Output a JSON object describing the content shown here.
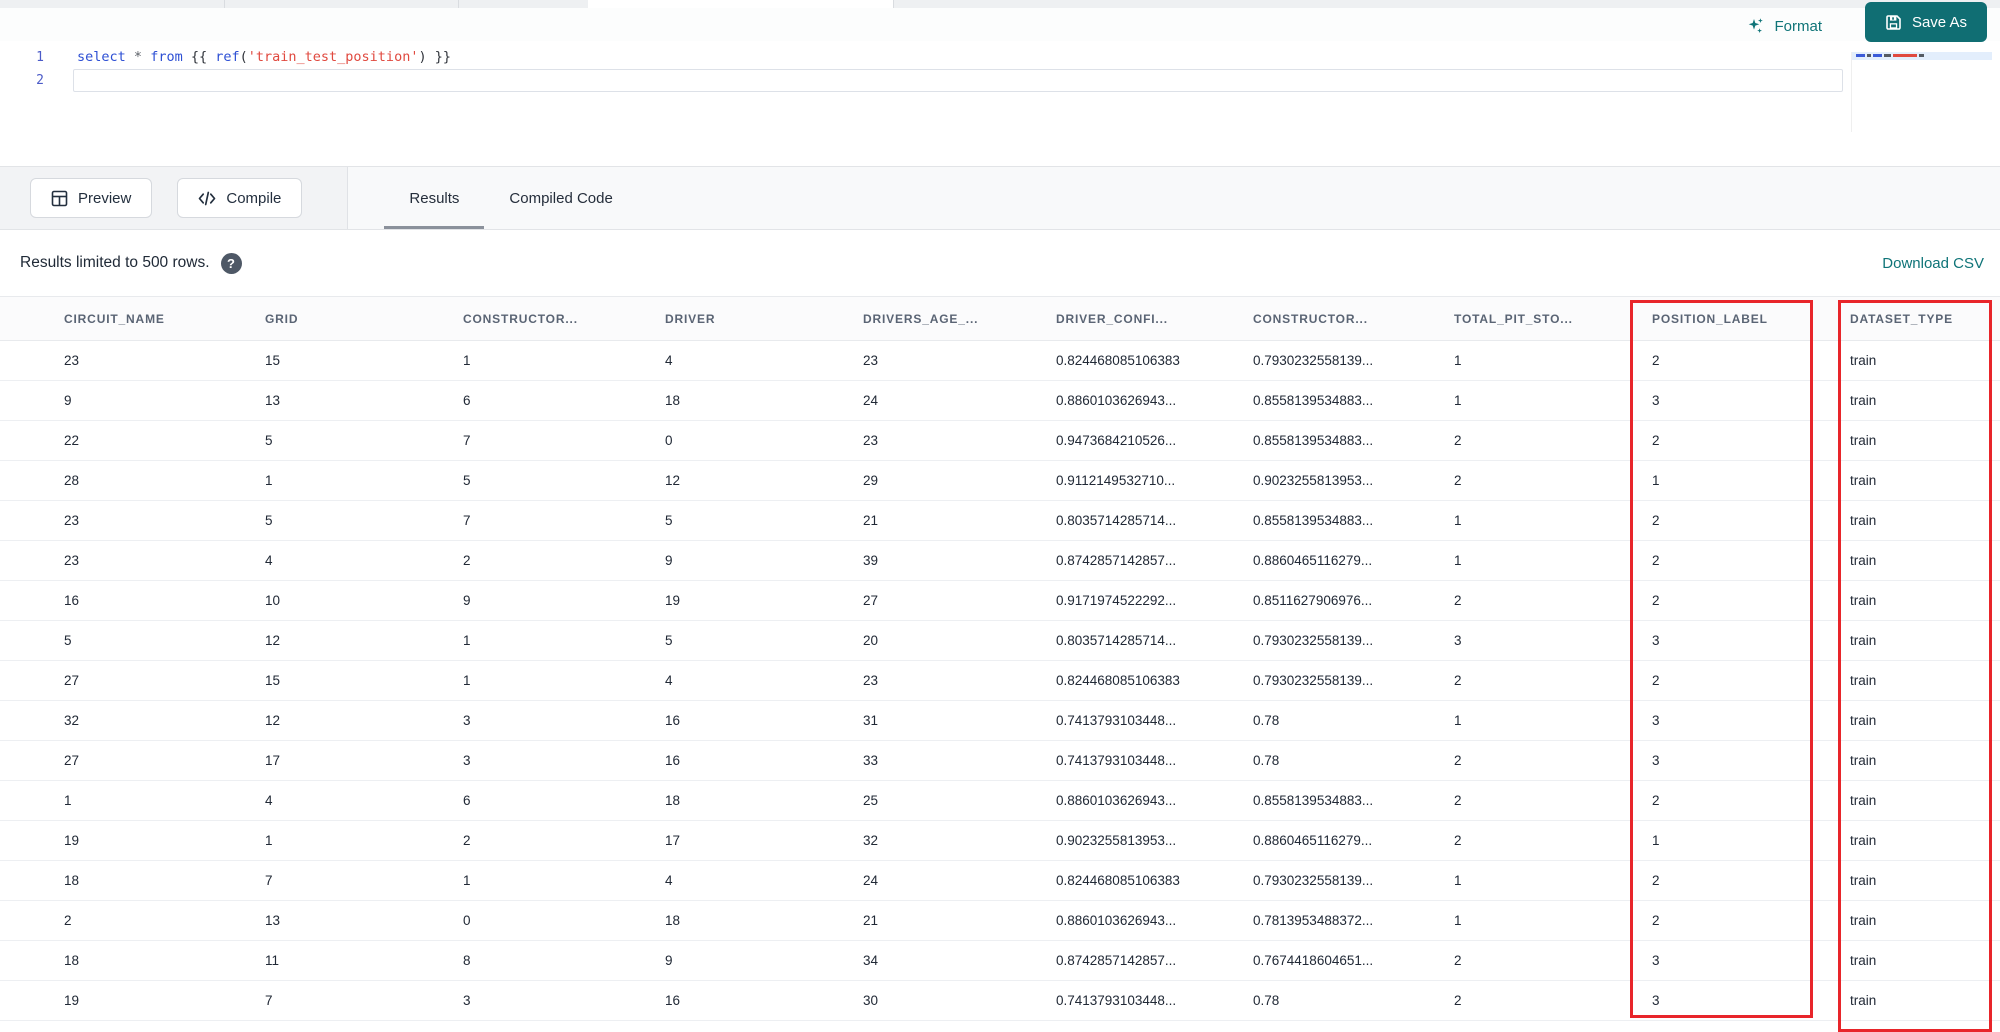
{
  "app": {
    "format_label": "Format",
    "save_as_label": "Save As"
  },
  "editor": {
    "line_numbers": [
      "1",
      "2"
    ],
    "tokens": [
      {
        "text": "select",
        "type": "keyword"
      },
      {
        "text": " ",
        "type": "plain"
      },
      {
        "text": "*",
        "type": "operator"
      },
      {
        "text": " ",
        "type": "plain"
      },
      {
        "text": "from",
        "type": "keyword"
      },
      {
        "text": " {{ ",
        "type": "plain"
      },
      {
        "text": "ref",
        "type": "function"
      },
      {
        "text": "(",
        "type": "plain"
      },
      {
        "text": "'train_test_position'",
        "type": "string"
      },
      {
        "text": ")",
        "type": "plain"
      },
      {
        "text": " }}",
        "type": "plain"
      }
    ]
  },
  "toolbar": {
    "preview_label": "Preview",
    "compile_label": "Compile"
  },
  "tabs": [
    {
      "label": "Results",
      "active": true
    },
    {
      "label": "Compiled Code",
      "active": false
    }
  ],
  "results_bar": {
    "message": "Results limited to 500 rows.",
    "help_icon": "?",
    "download_label": "Download CSV"
  },
  "table": {
    "columns": [
      "CIRCUIT_NAME",
      "GRID",
      "CONSTRUCTOR...",
      "DRIVER",
      "DRIVERS_AGE_...",
      "DRIVER_CONFI...",
      "CONSTRUCTOR...",
      "TOTAL_PIT_STO...",
      "POSITION_LABEL",
      "DATASET_TYPE"
    ],
    "rows": [
      [
        "23",
        "15",
        "1",
        "4",
        "23",
        "0.824468085106383",
        "0.7930232558139...",
        "1",
        "2",
        "train"
      ],
      [
        "9",
        "13",
        "6",
        "18",
        "24",
        "0.8860103626943...",
        "0.8558139534883...",
        "1",
        "3",
        "train"
      ],
      [
        "22",
        "5",
        "7",
        "0",
        "23",
        "0.9473684210526...",
        "0.8558139534883...",
        "2",
        "2",
        "train"
      ],
      [
        "28",
        "1",
        "5",
        "12",
        "29",
        "0.9112149532710...",
        "0.9023255813953...",
        "2",
        "1",
        "train"
      ],
      [
        "23",
        "5",
        "7",
        "5",
        "21",
        "0.8035714285714...",
        "0.8558139534883...",
        "1",
        "2",
        "train"
      ],
      [
        "23",
        "4",
        "2",
        "9",
        "39",
        "0.8742857142857...",
        "0.8860465116279...",
        "1",
        "2",
        "train"
      ],
      [
        "16",
        "10",
        "9",
        "19",
        "27",
        "0.9171974522292...",
        "0.8511627906976...",
        "2",
        "2",
        "train"
      ],
      [
        "5",
        "12",
        "1",
        "5",
        "20",
        "0.8035714285714...",
        "0.7930232558139...",
        "3",
        "3",
        "train"
      ],
      [
        "27",
        "15",
        "1",
        "4",
        "23",
        "0.824468085106383",
        "0.7930232558139...",
        "2",
        "2",
        "train"
      ],
      [
        "32",
        "12",
        "3",
        "16",
        "31",
        "0.7413793103448...",
        "0.78",
        "1",
        "3",
        "train"
      ],
      [
        "27",
        "17",
        "3",
        "16",
        "33",
        "0.7413793103448...",
        "0.78",
        "2",
        "3",
        "train"
      ],
      [
        "1",
        "4",
        "6",
        "18",
        "25",
        "0.8860103626943...",
        "0.8558139534883...",
        "2",
        "2",
        "train"
      ],
      [
        "19",
        "1",
        "2",
        "17",
        "32",
        "0.9023255813953...",
        "0.8860465116279...",
        "2",
        "1",
        "train"
      ],
      [
        "18",
        "7",
        "1",
        "4",
        "24",
        "0.824468085106383",
        "0.7930232558139...",
        "1",
        "2",
        "train"
      ],
      [
        "2",
        "13",
        "0",
        "18",
        "21",
        "0.8860103626943...",
        "0.7813953488372...",
        "1",
        "2",
        "train"
      ],
      [
        "18",
        "11",
        "8",
        "9",
        "34",
        "0.8742857142857...",
        "0.7674418604651...",
        "2",
        "3",
        "train"
      ],
      [
        "19",
        "7",
        "3",
        "16",
        "30",
        "0.7413793103448...",
        "0.78",
        "2",
        "3",
        "train"
      ]
    ]
  },
  "annotations": {
    "color": "#e8252a",
    "boxes": [
      "POSITION_LABEL column highlight",
      "DATASET_TYPE column highlight"
    ]
  },
  "colors": {
    "accent_teal": "#106e73",
    "annotation_red": "#e8252a",
    "keyword_blue": "#2d4fd4",
    "string_red": "#e0493f"
  }
}
